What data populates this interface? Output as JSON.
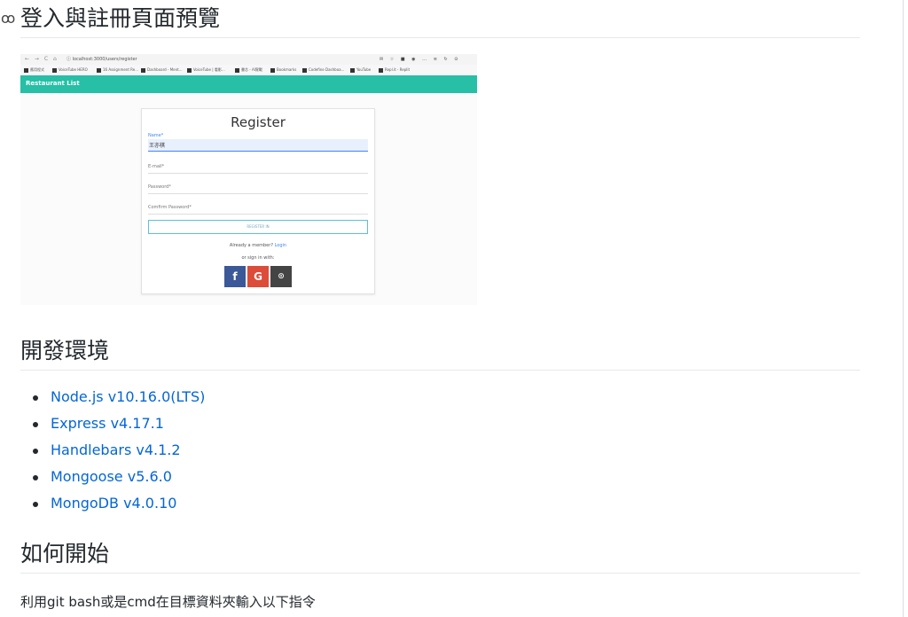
{
  "heading_preview": "登入與註冊頁面預覽",
  "anchor_glyph": "ꝏ",
  "screenshot": {
    "browser_controls": "← → C ⌂",
    "url": "ⓘ localhost:3000/users/register",
    "toolbar_icons": "✉ ☆ ■ ◉ … ≡ ↻ ⊙",
    "bookmarks": [
      "應用程式",
      "VoiceTube HERO",
      "16 Assignment Re...",
      "Dashboard - Ment...",
      "VoiceTube | 看影...",
      "書芯 - AI實戰",
      "Bookmarks",
      "Codefine Dashboa...",
      "YouTube",
      "Repl.it - Replit"
    ],
    "navbar_brand": "Restaurant List",
    "form_title": "Register",
    "name_label": "Name*",
    "name_value": "王亦棋",
    "email_label": "E-mail*",
    "password_label": "Password*",
    "confirm_label": "Comfirm Password*",
    "register_button": "REGISTER IN",
    "member_text": "Already a member?",
    "login_link": "Login",
    "or_text": "or sign in with:",
    "facebook_glyph": "f",
    "google_glyph": "G",
    "github_glyph": "⊙"
  },
  "heading_env": "開發環境",
  "env_items": [
    "Node.js v10.16.0(LTS)",
    "Express v4.17.1",
    "Handlebars v4.1.2",
    "Mongoose v5.6.0",
    "MongoDB v4.0.10"
  ],
  "heading_start": "如何開始",
  "start_text": "利用git bash或是cmd在目標資料夾輸入以下指令",
  "colors": {
    "link": "#0366d6",
    "navbar": "#27bfa6",
    "text": "#24292e"
  }
}
